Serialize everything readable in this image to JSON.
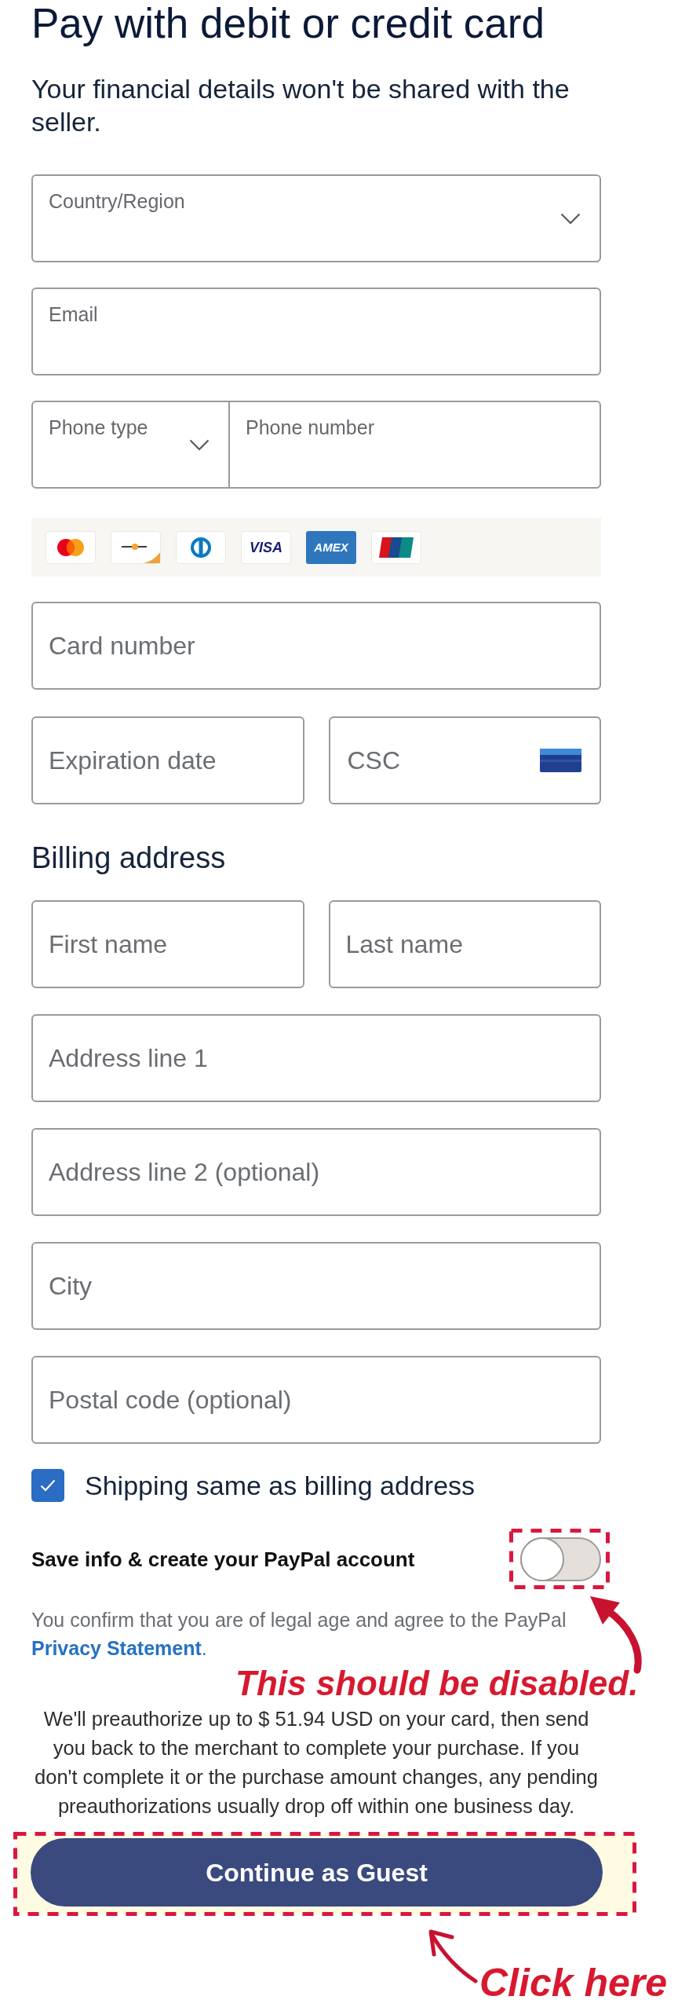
{
  "title": "Pay with debit or credit card",
  "subtitle": "Your financial details won't be shared with the seller.",
  "contact": [
    [
      {
        "kind": "dropdown",
        "placeholder": "Country/Region"
      }
    ],
    [
      {
        "kind": "floating",
        "placeholder": "Email"
      }
    ],
    [
      {
        "kind": "dropdown",
        "placeholder": "Phone type"
      },
      {
        "kind": "floating",
        "placeholder": "Phone number"
      }
    ]
  ],
  "card_logos": [
    {
      "kind": "circles"
    },
    {
      "kind": "dash"
    },
    {
      "kind": "ring"
    },
    {
      "kind": "wordmark",
      "text": "VISA"
    },
    {
      "kind": "tile",
      "text": "AMEX"
    },
    {
      "kind": "stripes"
    }
  ],
  "card": [
    [
      {
        "kind": "plain",
        "placeholder": "Card number"
      }
    ],
    [
      {
        "kind": "plain",
        "placeholder": "Expiration date"
      },
      {
        "kind": "code",
        "placeholder": "CSC"
      }
    ]
  ],
  "billing": {
    "heading": "Billing address",
    "rows": [
      [
        {
          "kind": "plain",
          "placeholder": "First name"
        },
        {
          "kind": "plain",
          "placeholder": "Last name"
        }
      ],
      [
        {
          "kind": "plain",
          "placeholder": "Address line 1"
        }
      ],
      [
        {
          "kind": "plain",
          "placeholder": "Address line 2 (optional)"
        }
      ],
      [
        {
          "kind": "plain",
          "placeholder": "City"
        }
      ],
      [
        {
          "kind": "plain",
          "placeholder": "Postal code (optional)"
        }
      ]
    ]
  },
  "shipping_same": {
    "label": "Shipping same as billing address",
    "checked": true
  },
  "save_account": {
    "label": "Save info & create your PayPal account",
    "on": false
  },
  "legal": {
    "text": "You confirm that you are of legal age and agree to the PayPal",
    "link": "Privacy Statement",
    "end": "."
  },
  "preauth_note": "We'll preauthorize up to $ 51.94 USD on your card, then send you back to the merchant to complete your purchase. If you don't complete it or the purchase amount changes, any pending preauthorizations usually drop off within one business day.",
  "continue_button": "Continue as Guest",
  "annotations": [
    "This should be disabled.",
    "Click here"
  ]
}
